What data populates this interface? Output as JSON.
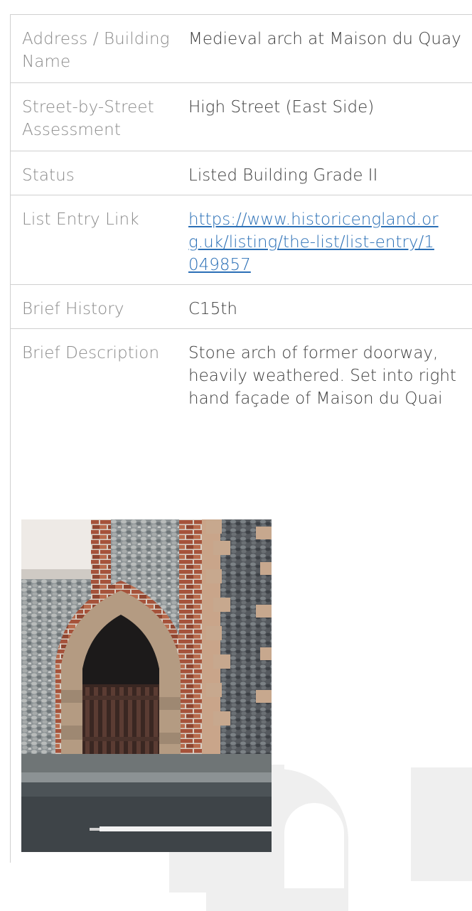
{
  "rows": [
    {
      "label": "Address / Building Name",
      "value": "Medieval arch at Maison du Quay"
    },
    {
      "label": "Street-by-Street Assessment",
      "value": "High Street (East Side)"
    },
    {
      "label": "Status",
      "value": "Listed Building Grade II"
    },
    {
      "label": "List Entry Link",
      "value": "https://www.historicengland.org.uk/listing/the-list/list-entry/1049857"
    },
    {
      "label": "Brief History",
      "value": "C15th"
    },
    {
      "label": "Brief Description",
      "value": "Stone arch of former doorway, heavily weathered. Set into right hand façade of Maison du Quai"
    }
  ],
  "photo": {
    "icon": "archway-photo"
  },
  "colors": {
    "label": "#8a8a8a",
    "value": "#3d3d3d",
    "link": "#2a6fb6",
    "border": "#d0d0d0"
  }
}
